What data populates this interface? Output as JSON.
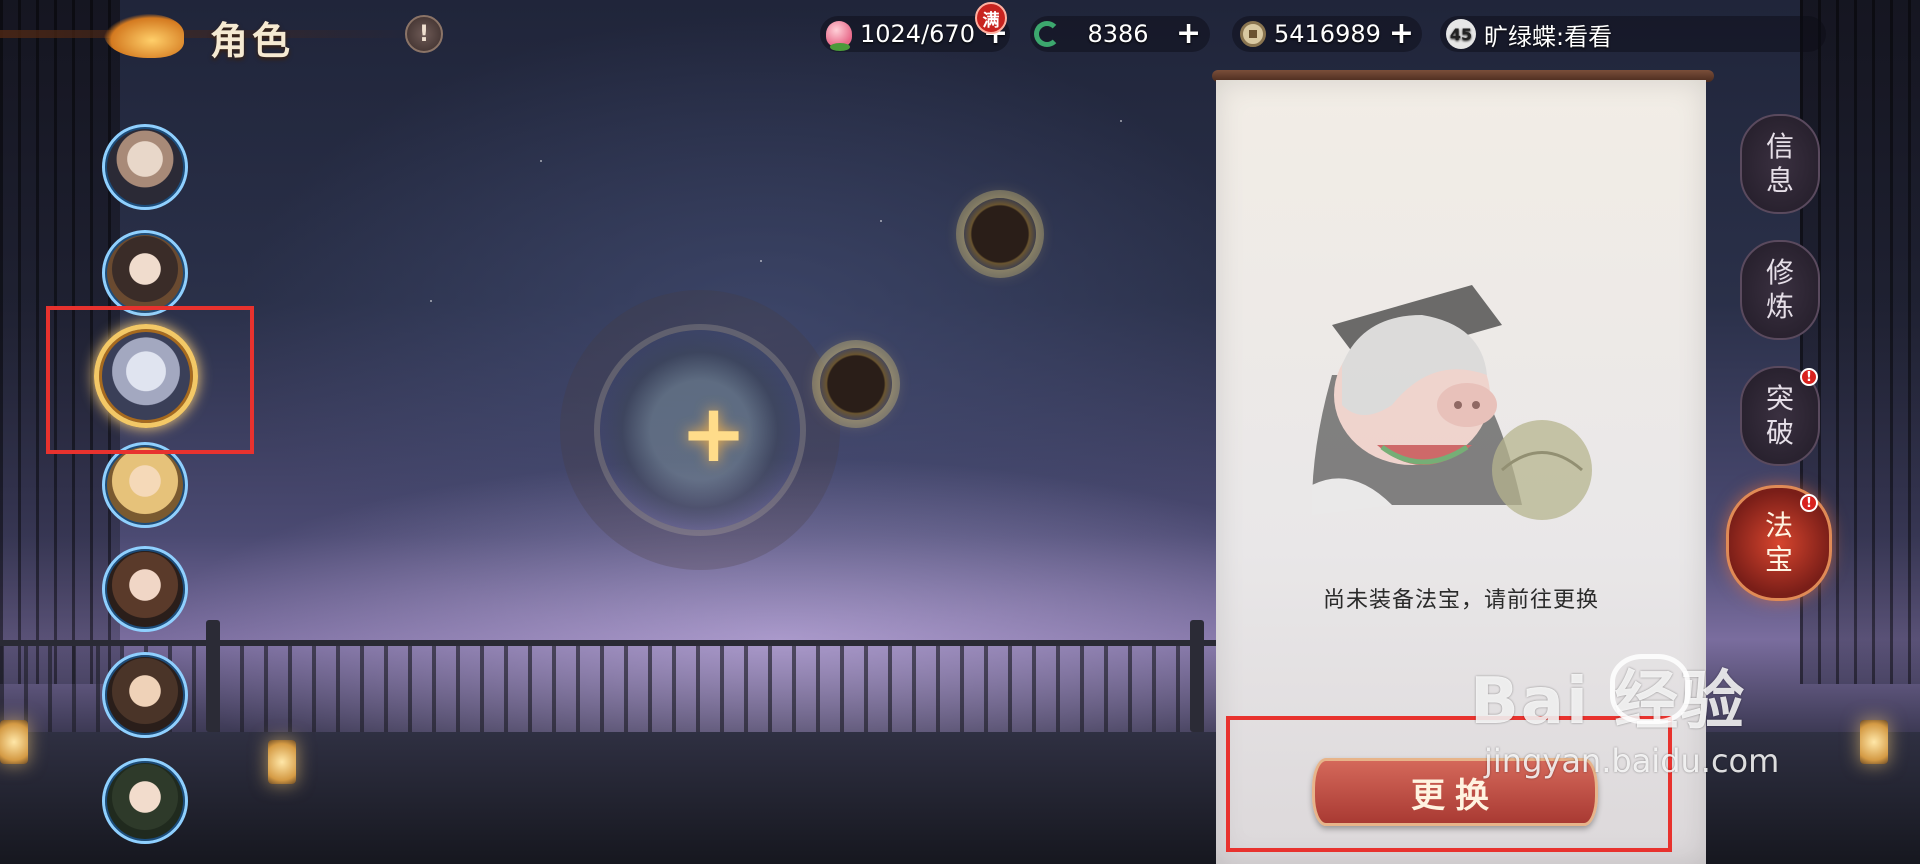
{
  "header": {
    "title": "角色",
    "info_glyph": "!"
  },
  "resources": {
    "stamina": {
      "value": "1024/670",
      "badge": "满"
    },
    "jade": {
      "value": "8386"
    },
    "coins": {
      "value": "5416989"
    },
    "plus_glyph": "+"
  },
  "player": {
    "level": "45",
    "name": "旷绿蝶:看看"
  },
  "center": {
    "slot_plus": "+"
  },
  "panel": {
    "empty_message": "尚未装备法宝，请前往更换",
    "swap_label": "更换"
  },
  "side_tabs": [
    {
      "label_top": "信",
      "label_bottom": "息"
    },
    {
      "label_top": "修",
      "label_bottom": "炼"
    },
    {
      "label_top": "突",
      "label_bottom": "破",
      "badge": "!"
    },
    {
      "label_top": "法",
      "label_bottom": "宝",
      "badge": "!"
    }
  ],
  "watermark": {
    "main": "Bai  经验",
    "sub": "jingyan.baidu.com"
  },
  "colors": {
    "highlight": "#e8322e",
    "accent_gold": "#f3c866",
    "button_red": "#a93a33"
  }
}
